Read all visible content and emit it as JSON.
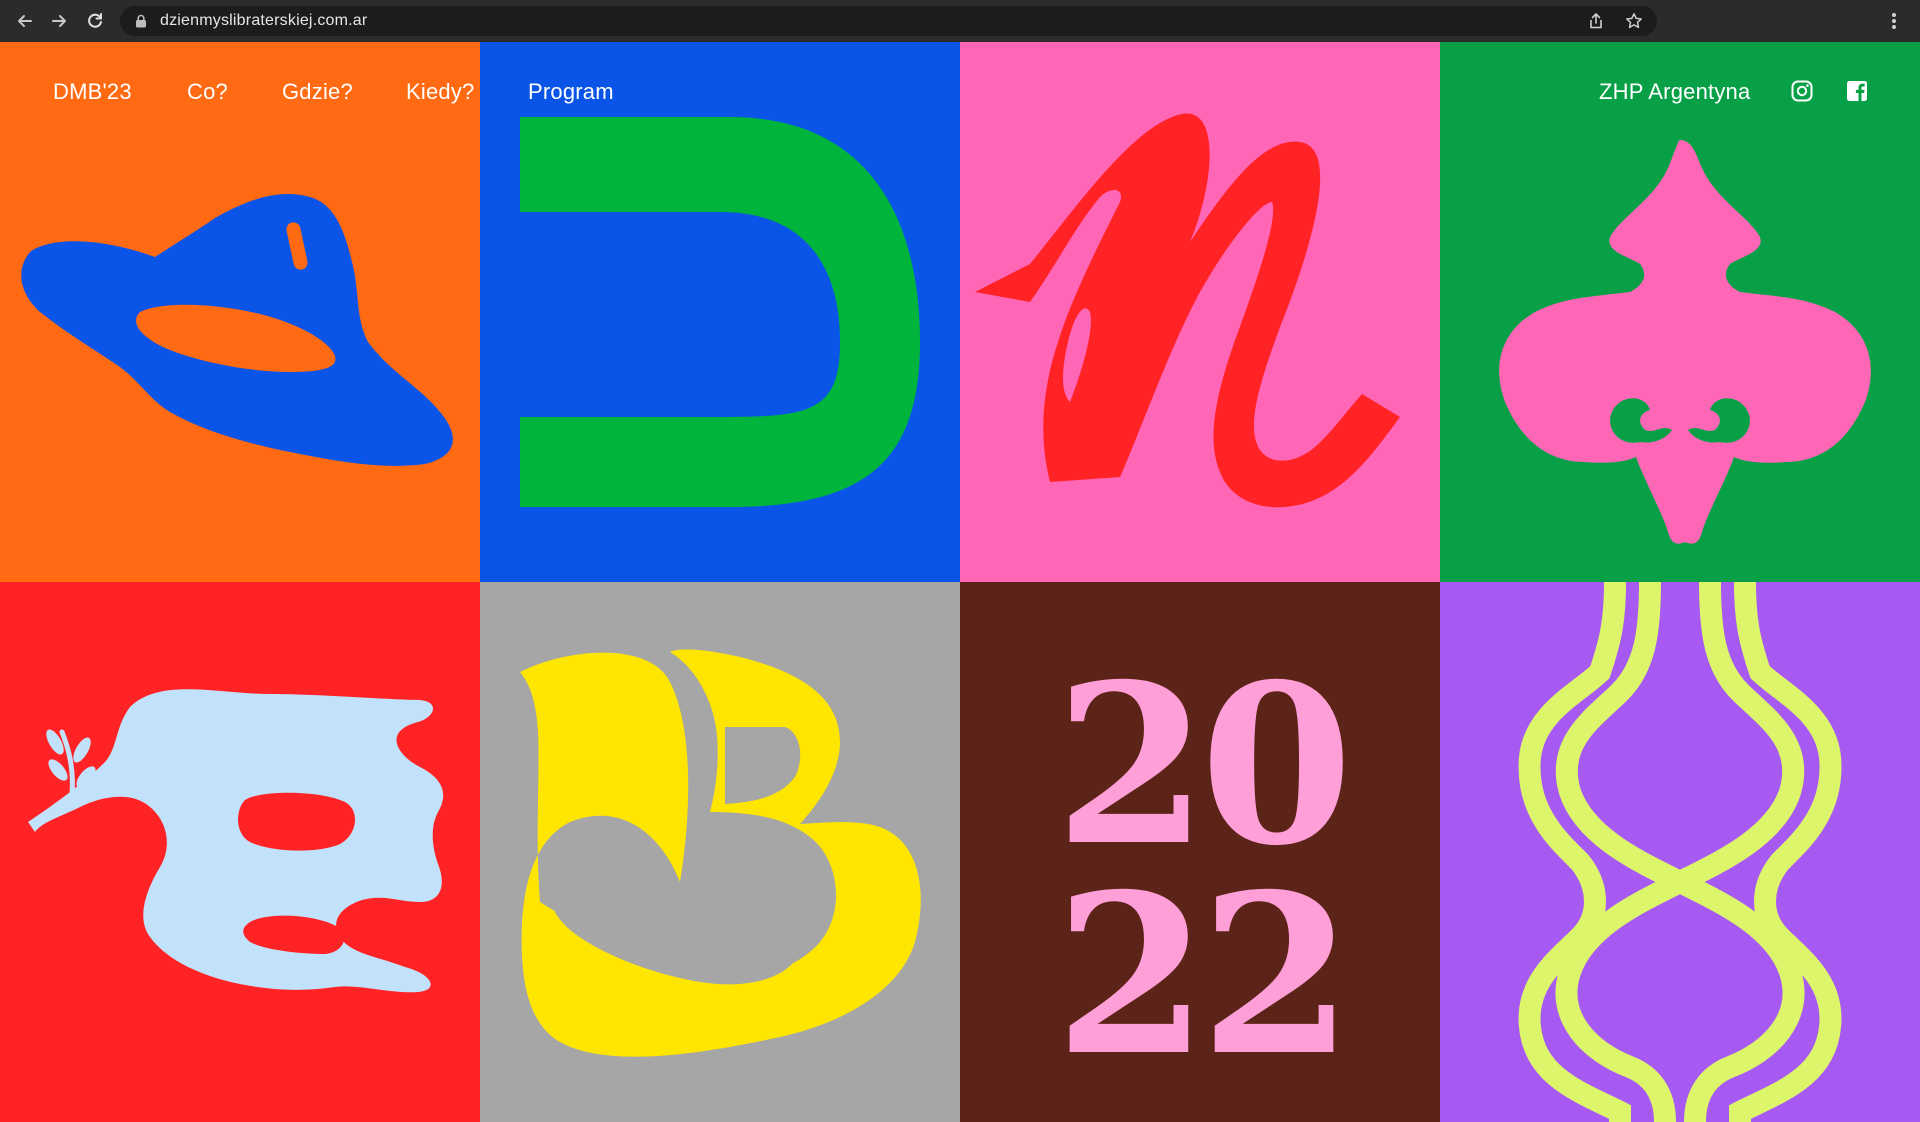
{
  "browser": {
    "url": "dzienmyslibraterskiej.com.ar",
    "back_icon": "arrow-left-icon",
    "forward_icon": "arrow-right-icon",
    "reload_icon": "reload-icon",
    "lock_icon": "lock-icon",
    "share_icon": "share-icon",
    "bookmark_icon": "star-icon",
    "menu_icon": "kebab-menu-icon"
  },
  "nav": {
    "home": "DMB'23",
    "what": "Co?",
    "where": "Gdzie?",
    "when": "Kiedy?",
    "program": "Program",
    "org": "ZHP Argentyna",
    "instagram_icon": "instagram-icon",
    "facebook_icon": "facebook-icon"
  },
  "tiles": {
    "hat": {
      "bg": "#ff6a13",
      "fg": "#0a55e8",
      "icon": "scout-hat-icon"
    },
    "letter_d": {
      "bg": "#0a55e8",
      "fg": "#00b43c",
      "glyph": "D"
    },
    "letter_m": {
      "bg": "#ff66b6",
      "fg": "#ff2326",
      "glyph": "M"
    },
    "fleur": {
      "bg": "#08a047",
      "fg": "#ff66b6",
      "icon": "fleur-de-lis-icon"
    },
    "dove": {
      "bg": "#ff2326",
      "fg": "#c2e2fb",
      "icon": "dove-icon"
    },
    "letter_b": {
      "bg": "#a6a6a6",
      "fg": "#ffe600",
      "glyph": "B"
    },
    "year": {
      "bg": "#5c2419",
      "fg": "#ff9fd7",
      "lines": [
        "20",
        "22"
      ]
    },
    "knot": {
      "bg": "#a75af2",
      "fg": "#dcf56a",
      "icon": "square-knot-icon"
    }
  }
}
